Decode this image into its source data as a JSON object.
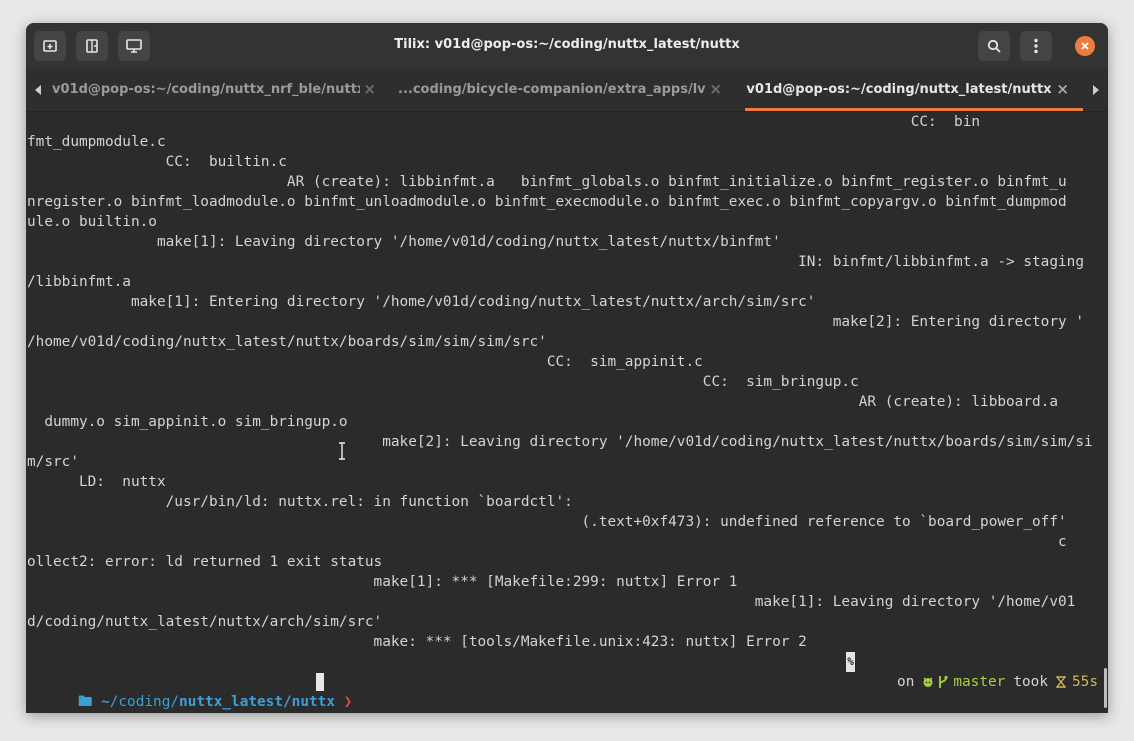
{
  "window": {
    "title": "Tilix: v01d@pop-os:~/coding/nuttx_latest/nuttx"
  },
  "toolbar": {
    "buttons": [
      {
        "name": "add-terminal-right-button",
        "icon": "add-terminal-icon"
      },
      {
        "name": "add-terminal-down-button",
        "icon": "split-icon"
      },
      {
        "name": "session-button",
        "icon": "session-icon"
      }
    ],
    "search_icon": "search-icon",
    "menu_icon": "menu-icon",
    "close_icon": "close-icon"
  },
  "tabs": [
    {
      "label": "v01d@pop-os:~/coding/nuttx_nrf_ble/nuttx",
      "close": "×",
      "active": false
    },
    {
      "label": "...coding/bicycle-companion/extra_apps/lvgl",
      "close": "×",
      "active": false
    },
    {
      "label": "v01d@pop-os:~/coding/nuttx_latest/nuttx",
      "close": "×",
      "active": true
    }
  ],
  "colors": {
    "accent": "#ef7b3c",
    "background": "#2b2b2b",
    "text": "#d3d3d3",
    "prompt_dir": "#3b9fd8",
    "prompt_arrow": "#e0444b",
    "git_branch": "#a6d040",
    "duration": "#c9b65e"
  },
  "terminal": {
    "lines": [
      "                                                                                                      CC:  bin",
      "fmt_dumpmodule.c",
      "                CC:  builtin.c",
      "                              AR (create): libbinfmt.a   binfmt_globals.o binfmt_initialize.o binfmt_register.o binfmt_u",
      "nregister.o binfmt_loadmodule.o binfmt_unloadmodule.o binfmt_execmodule.o binfmt_exec.o binfmt_copyargv.o binfmt_dumpmod",
      "ule.o builtin.o",
      "               make[1]: Leaving directory '/home/v01d/coding/nuttx_latest/nuttx/binfmt'",
      "                                                                                         IN: binfmt/libbinfmt.a -> staging",
      "/libbinfmt.a",
      "            make[1]: Entering directory '/home/v01d/coding/nuttx_latest/nuttx/arch/sim/src'",
      "                                                                                             make[2]: Entering directory '",
      "/home/v01d/coding/nuttx_latest/nuttx/boards/sim/sim/sim/src'",
      "                                                            CC:  sim_appinit.c",
      "                                                                              CC:  sim_bringup.c",
      "                                                                                                AR (create): libboard.a",
      "  dummy.o sim_appinit.o sim_bringup.o",
      "                                         make[2]: Leaving directory '/home/v01d/coding/nuttx_latest/nuttx/boards/sim/sim/si",
      "m/src'",
      "      LD:  nuttx",
      "                /usr/bin/ld: nuttx.rel: in function `boardctl':",
      "                                                                (.text+0xf473): undefined reference to `board_power_off'",
      "                                                                                                                       c",
      "ollect2: error: ld returned 1 exit status",
      "                                        make[1]: *** [Makefile:299: nuttx] Error 1",
      "                                                                                    make[1]: Leaving directory '/home/v01",
      "d/coding/nuttx_latest/nuttx/arch/sim/src'",
      "                                        make: *** [tools/Makefile.unix:423: nuttx] Error 2"
    ],
    "eol_marker": "%",
    "prompt": {
      "folder_icon": "folder-icon",
      "tilde": "~",
      "path_prefix": "/coding/",
      "path_bold": "nuttx_latest/nuttx",
      "arrow": "❯"
    },
    "right_prompt": {
      "on": "on",
      "github_icon": "github-icon",
      "branch_icon": "git-branch-icon",
      "branch": "master",
      "took": "took",
      "hourglass_icon": "hourglass-icon",
      "duration": "55s"
    }
  }
}
